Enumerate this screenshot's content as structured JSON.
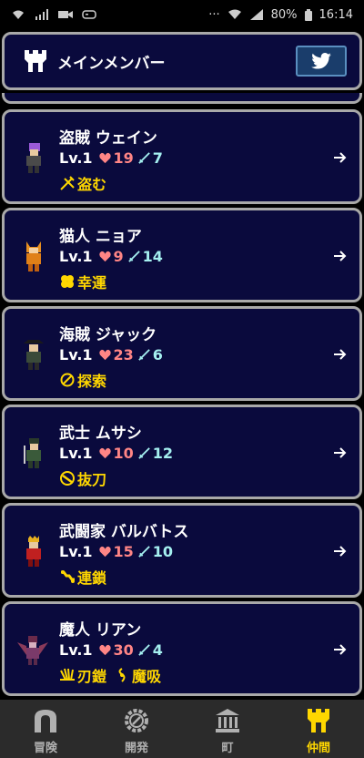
{
  "status_bar": {
    "battery": "80%",
    "time": "16:14"
  },
  "header": {
    "title": "メインメンバー",
    "twitter_icon": "twitter-bird-icon"
  },
  "members": [
    {
      "name": "盗賊 ウェイン",
      "level": "Lv.1",
      "hp": "19",
      "atk": "7",
      "skills": [
        {
          "icon": "steal-icon",
          "label": "盗む"
        }
      ]
    },
    {
      "name": "猫人 ニョア",
      "level": "Lv.1",
      "hp": "9",
      "atk": "14",
      "skills": [
        {
          "icon": "clover-icon",
          "label": "幸運"
        }
      ]
    },
    {
      "name": "海賊 ジャック",
      "level": "Lv.1",
      "hp": "23",
      "atk": "6",
      "skills": [
        {
          "icon": "search-icon",
          "label": "探索"
        }
      ]
    },
    {
      "name": "武士 ムサシ",
      "level": "Lv.1",
      "hp": "10",
      "atk": "12",
      "skills": [
        {
          "icon": "slash-icon",
          "label": "抜刀"
        }
      ]
    },
    {
      "name": "武闘家 バルバトス",
      "level": "Lv.1",
      "hp": "15",
      "atk": "10",
      "skills": [
        {
          "icon": "chain-icon",
          "label": "連鎖"
        }
      ]
    },
    {
      "name": "魔人 リアン",
      "level": "Lv.1",
      "hp": "30",
      "atk": "4",
      "skills": [
        {
          "icon": "claw-icon",
          "label": "刃鎧"
        },
        {
          "icon": "drain-icon",
          "label": "魔吸"
        }
      ]
    }
  ],
  "tabs": [
    {
      "label": "冒険",
      "icon": "gate-icon",
      "active": false
    },
    {
      "label": "開発",
      "icon": "gear-icon",
      "active": false
    },
    {
      "label": "町",
      "icon": "bank-icon",
      "active": false
    },
    {
      "label": "仲間",
      "icon": "castle-icon",
      "active": true
    }
  ],
  "colors": {
    "panel_bg": "#0a0a3d",
    "panel_border": "#a9a9a9",
    "hp": "#ff8585",
    "atk": "#a5f0f0",
    "skill": "#ffd700"
  }
}
